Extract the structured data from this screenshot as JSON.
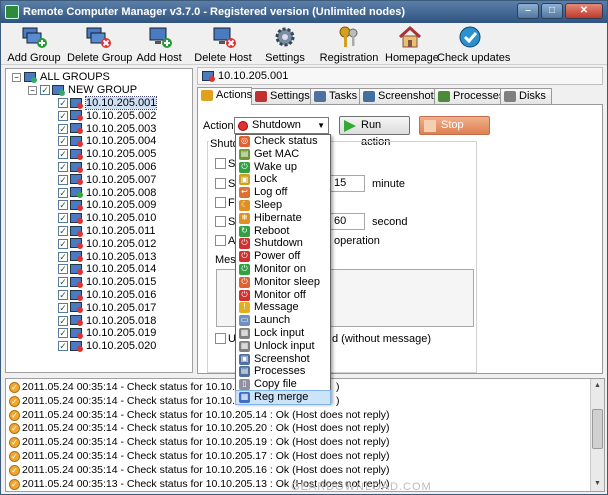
{
  "window": {
    "title": "Remote Computer Manager v3.7.0 - Registered version (Unlimited nodes)",
    "min": "–",
    "max": "□",
    "close": "✕"
  },
  "toolbar": [
    {
      "label": "Add Group",
      "icon": "add-group-icon"
    },
    {
      "label": "Delete Group",
      "icon": "delete-group-icon"
    },
    {
      "label": "Add Host",
      "icon": "add-host-icon"
    },
    {
      "label": "Delete Host",
      "icon": "delete-host-icon"
    },
    {
      "label": "Settings",
      "icon": "gear-icon"
    },
    {
      "label": "Registration",
      "icon": "keys-icon"
    },
    {
      "label": "Homepage",
      "icon": "home-icon"
    },
    {
      "label": "Check updates",
      "icon": "checkmark-icon"
    }
  ],
  "tree": {
    "root": "ALL GROUPS",
    "group": "NEW GROUP",
    "hosts": [
      "10.10.205.001",
      "10.10.205.002",
      "10.10.205.003",
      "10.10.205.004",
      "10.10.205.005",
      "10.10.205.006",
      "10.10.205.007",
      "10.10.205.008",
      "10.10.205.009",
      "10.10.205.010",
      "10.10.205.011",
      "10.10.205.012",
      "10.10.205.013",
      "10.10.205.014",
      "10.10.205.015",
      "10.10.205.016",
      "10.10.205.017",
      "10.10.205.018",
      "10.10.205.019",
      "10.10.205.020"
    ],
    "selected_index": 0,
    "online_indices": [
      7
    ]
  },
  "host_header": "10.10.205.001",
  "tabs": [
    "Actions",
    "Settings",
    "Tasks",
    "Screenshot",
    "Processes",
    "Disks"
  ],
  "actions": {
    "action_label": "Action:",
    "selected": "Shutdown",
    "run": "Run action",
    "stop": "Stop action",
    "group_label": "Shutd",
    "row_labels": [
      "Sk",
      "Sk",
      "Fo",
      "Sh",
      "Al",
      "Mess"
    ],
    "field1": "15",
    "field1_unit": "minute",
    "field2": "60",
    "field2_unit": "second",
    "operation_text": "operation",
    "bottom_check_prefix": "U",
    "bottom_check_suffix": "d (without message)"
  },
  "dropdown": [
    {
      "label": "Check status",
      "color": "#e06030",
      "glyph": "◎"
    },
    {
      "label": "Get MAC",
      "color": "#6a9a30",
      "glyph": "▤"
    },
    {
      "label": "Wake up",
      "color": "#30a040",
      "glyph": "⏻"
    },
    {
      "label": "Lock",
      "color": "#d0a020",
      "glyph": "▣"
    },
    {
      "label": "Log off",
      "color": "#e07030",
      "glyph": "↩"
    },
    {
      "label": "Sleep",
      "color": "#e09020",
      "glyph": "☾"
    },
    {
      "label": "Hibernate",
      "color": "#e09020",
      "glyph": "❄"
    },
    {
      "label": "Reboot",
      "color": "#30a040",
      "glyph": "↻"
    },
    {
      "label": "Shutdown",
      "color": "#d03030",
      "glyph": "⏻"
    },
    {
      "label": "Power off",
      "color": "#d03030",
      "glyph": "⏻"
    },
    {
      "label": "Monitor on",
      "color": "#30a040",
      "glyph": "⏻"
    },
    {
      "label": "Monitor sleep",
      "color": "#e06030",
      "glyph": "⏻"
    },
    {
      "label": "Monitor off",
      "color": "#d03030",
      "glyph": "⏻"
    },
    {
      "label": "Message",
      "color": "#e0b020",
      "glyph": "!"
    },
    {
      "label": "Launch",
      "color": "#7090c0",
      "glyph": "▭"
    },
    {
      "label": "Lock input",
      "color": "#808080",
      "glyph": "▦"
    },
    {
      "label": "Unlock input",
      "color": "#808080",
      "glyph": "▦"
    },
    {
      "label": "Screenshot",
      "color": "#5070a0",
      "glyph": "▣"
    },
    {
      "label": "Processes",
      "color": "#5070a0",
      "glyph": "▤"
    },
    {
      "label": "Copy file",
      "color": "#9090a0",
      "glyph": "▯"
    },
    {
      "label": "Reg merge",
      "color": "#4070c0",
      "glyph": "▦"
    }
  ],
  "dropdown_highlight": 20,
  "log": [
    "2011.05.24 00:35:14 - Check status for 10.10.205.18",
    "2011.05.24 00:35:14 - Check status for 10.10.205.15",
    "2011.05.24 00:35:14 - Check status for 10.10.205.14 : Ok (Host does not reply)",
    "2011.05.24 00:35:14 - Check status for 10.10.205.20 : Ok (Host does not reply)",
    "2011.05.24 00:35:14 - Check status for 10.10.205.19 : Ok (Host does not reply)",
    "2011.05.24 00:35:14 - Check status for 10.10.205.17 : Ok (Host does not reply)",
    "2011.05.24 00:35:14 - Check status for 10.10.205.16 : Ok (Host does not reply)",
    "2011.05.24 00:35:13 - Check status for 10.10.205.13 : Ok (Host does not reply)"
  ],
  "log_tail": [
    ") ",
    ") "
  ],
  "watermark": "GEARDOWNLOAD.COM"
}
